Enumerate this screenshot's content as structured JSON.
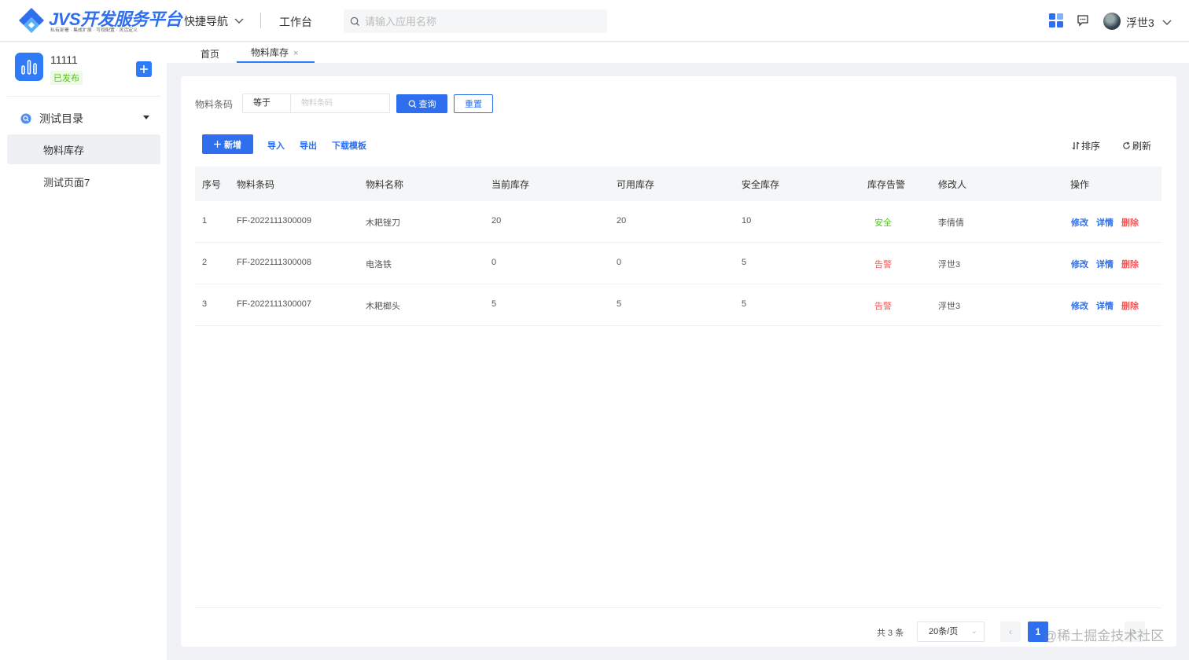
{
  "header": {
    "logo_title": "JVS开发服务平台",
    "logo_sub": "私有部署 · 集成扩展 · 可视配置 · 灵活定义",
    "quick_nav": "快捷导航",
    "workbench": "工作台",
    "search_placeholder": "请输入应用名称",
    "username": "浮世3"
  },
  "sidebar": {
    "app_name": "11111",
    "app_status": "已发布",
    "group_label": "测试目录",
    "items": [
      {
        "label": "物料库存",
        "active": true
      },
      {
        "label": "测试页面7",
        "active": false
      }
    ]
  },
  "tabs": [
    {
      "label": "首页"
    },
    {
      "label": "物料库存",
      "close": "×"
    }
  ],
  "filter": {
    "label": "物料条码",
    "operator": "等于",
    "placeholder": "物料条码",
    "query_label": "查询",
    "reset_label": "重置"
  },
  "toolbar": {
    "add_label": "新增",
    "import_label": "导入",
    "export_label": "导出",
    "template_label": "下载模板",
    "sort_label": "排序",
    "refresh_label": "刷新"
  },
  "table": {
    "columns": [
      "序号",
      "物料条码",
      "物料名称",
      "当前库存",
      "可用库存",
      "安全库存",
      "库存告警",
      "修改人",
      "操作"
    ],
    "rows": [
      {
        "no": "1",
        "code": "FF-2022111300009",
        "name": "木耙锉刀",
        "current": "20",
        "available": "20",
        "safety": "10",
        "alert": "安全",
        "alert_type": "safe",
        "modifier": "李倩倩"
      },
      {
        "no": "2",
        "code": "FF-2022111300008",
        "name": "电洛铁",
        "current": "0",
        "available": "0",
        "safety": "5",
        "alert": "告警",
        "alert_type": "warn",
        "modifier": "浮世3"
      },
      {
        "no": "3",
        "code": "FF-2022111300007",
        "name": "木耙榔头",
        "current": "5",
        "available": "5",
        "safety": "5",
        "alert": "告警",
        "alert_type": "warn",
        "modifier": "浮世3"
      }
    ],
    "ops": {
      "edit": "修改",
      "detail": "详情",
      "delete": "删除"
    }
  },
  "pager": {
    "total": "共 3 条",
    "page_size": "20条/页",
    "current_page": "1",
    "prev": "‹",
    "next": "›"
  },
  "watermark": "@稀土掘金技术社区",
  "colors": {
    "primary": "#2f6fed",
    "safe": "#52c41a",
    "warn": "#f5595a"
  }
}
